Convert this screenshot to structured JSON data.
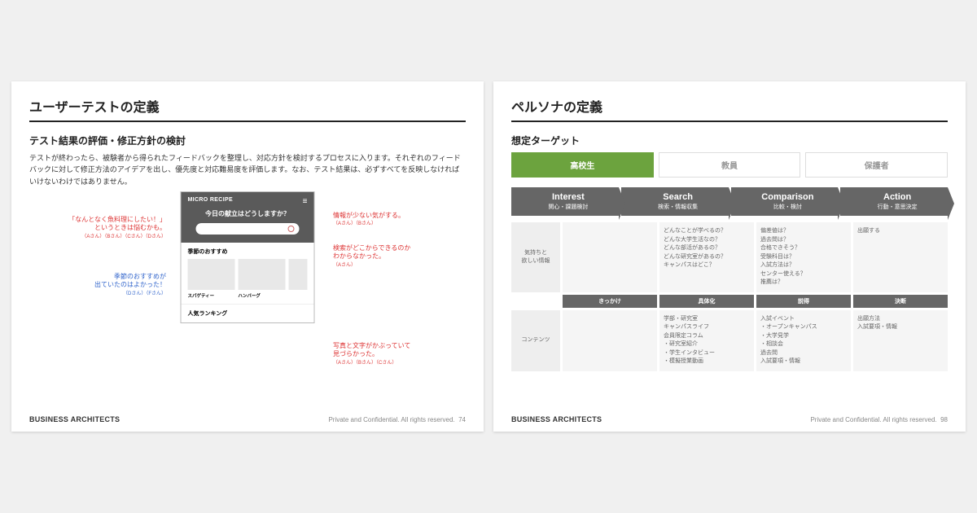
{
  "left": {
    "title": "ユーザーテストの定義",
    "subtitle": "テスト結果の評価・修正方針の検討",
    "body": "テストが終わったら、被験者から得られたフィードバックを整理し、対応方針を検討するプロセスに入ります。それぞれのフィードバックに対して修正方法のアイデアを出し、優先度と対応難易度を評価します。なお、テスト結果は、必ずすべてを反映しなければいけないわけではありません。",
    "mock": {
      "brand": "MICRO RECIPE",
      "question": "今日の献立はどうしますか？",
      "section1": "季節のおすすめ",
      "card1": "スパゲティー",
      "card2": "ハンバーグ",
      "section2": "人気ランキング"
    },
    "annot1": {
      "main": "「なんとなく魚料理にしたい！」\nというときは悩むかも。",
      "sub": "（Aさん）（Bさん）（Cさん）（Dさん）"
    },
    "annot2": {
      "main": "季節のおすすめが\n出ていたのはよかった！",
      "sub": "（Dさん）（Fさん）"
    },
    "annot3": {
      "main": "情報が少ない気がする。",
      "sub": "（Aさん）（Bさん）"
    },
    "annot4": {
      "main": "検索がどこからできるのか\nわからなかった。",
      "sub": "（Aさん）"
    },
    "annot5": {
      "main": "写真と文字がかぶっていて\n見づらかった。",
      "sub": "（Aさん）（Bさん）（Cさん）"
    },
    "page": "74"
  },
  "right": {
    "title": "ペルソナの定義",
    "subtitle": "想定ターゲット",
    "tabs": [
      "高校生",
      "教員",
      "保護者"
    ],
    "journey": [
      {
        "t": "Interest",
        "s": "関心・課題検討"
      },
      {
        "t": "Search",
        "s": "検索・情報収集"
      },
      {
        "t": "Comparison",
        "s": "比較・検討"
      },
      {
        "t": "Action",
        "s": "行動・意思決定"
      }
    ],
    "row1label": "気持ちと\n欲しい情報",
    "row1": [
      "",
      "どんなことが学べるの？\nどんな大学生活なの？\nどんな部活があるの？\nどんな研究室があるの？\nキャンパスはどこ？",
      "偏差値は？\n過去問は？\n合格できそう？\n受験科目は？\n入試方法は？\nセンター使える？\n推薦は？",
      "出願する"
    ],
    "tags": [
      "きっかけ",
      "具体化",
      "説得",
      "決断"
    ],
    "row2label": "コンテンツ",
    "row2": [
      "",
      "学部・研究室\nキャンパスライフ\n会員限定コラム\n・研究室紹介\n・学生インタビュー\n・模擬授業動画",
      "入試イベント\n・オープンキャンパス\n・大学見学\n・相談会\n過去問\n入試要項・情報",
      "出願方法\n入試要項・情報"
    ],
    "page": "98"
  },
  "footer": {
    "company": "BUSINESS ARCHITECTS",
    "confidential": "Private and Confidential. All rights reserved."
  }
}
